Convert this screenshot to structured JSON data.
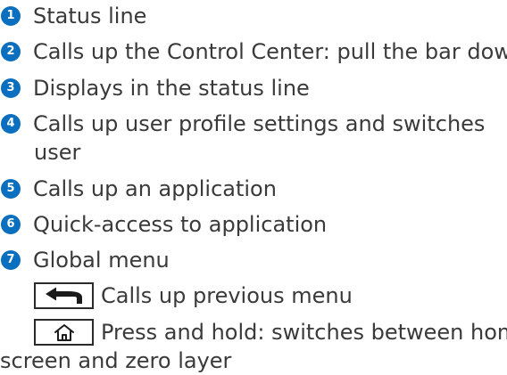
{
  "legend": {
    "items": [
      {
        "number": "1",
        "text": "Status line"
      },
      {
        "number": "2",
        "text": "Calls up the Control Center: pull the bar down"
      },
      {
        "number": "3",
        "text": "Displays in the status line"
      },
      {
        "number": "4",
        "text": "Calls up user profile settings and switches",
        "text_cont": "user"
      },
      {
        "number": "5",
        "text": "Calls up an application"
      },
      {
        "number": "6",
        "text": "Quick-access to application"
      },
      {
        "number": "7",
        "text": "Global menu"
      }
    ],
    "keys": [
      {
        "icon": "back-arrow-icon",
        "text": "Calls up previous menu"
      },
      {
        "icon": "home-icon",
        "text": "Press and hold: switches between home",
        "text_cont": "screen and zero layer"
      }
    ]
  },
  "colors": {
    "badge": "#0a6fbf",
    "text": "#3a3a3a"
  }
}
